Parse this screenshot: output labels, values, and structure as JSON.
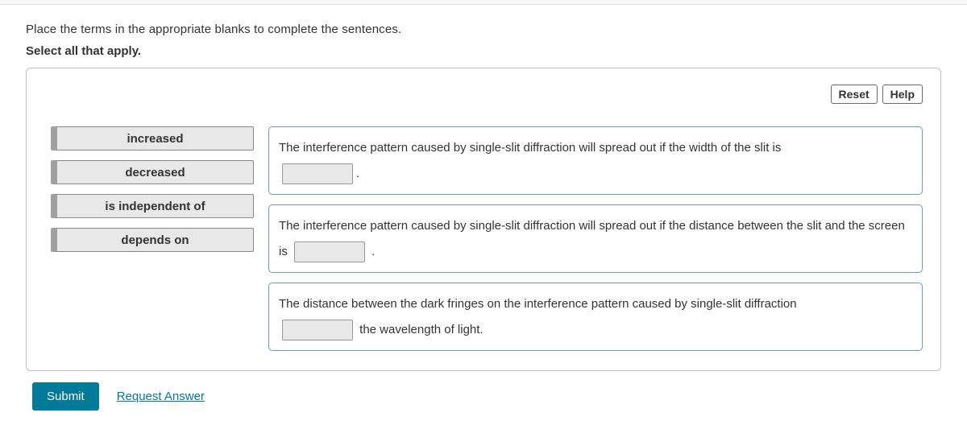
{
  "instructions": {
    "line1": "Place the terms in the appropriate blanks to complete the sentences.",
    "line2": "Select all that apply."
  },
  "controls": {
    "reset": "Reset",
    "help": "Help"
  },
  "terms": [
    "increased",
    "decreased",
    "is independent of",
    "depends on"
  ],
  "sentences": {
    "s1_part1": "The interference pattern caused by single-slit diffraction will spread out if the width of the slit is",
    "s1_part2": ".",
    "s2_part1": "The interference pattern caused by single-slit diffraction will spread out if the distance between the slit and the screen is ",
    "s2_part2": " .",
    "s3_part1": "The distance between the dark fringes on the interference pattern caused by single-slit diffraction",
    "s3_part2": " the wavelength of light."
  },
  "footer": {
    "submit": "Submit",
    "request": "Request Answer"
  }
}
